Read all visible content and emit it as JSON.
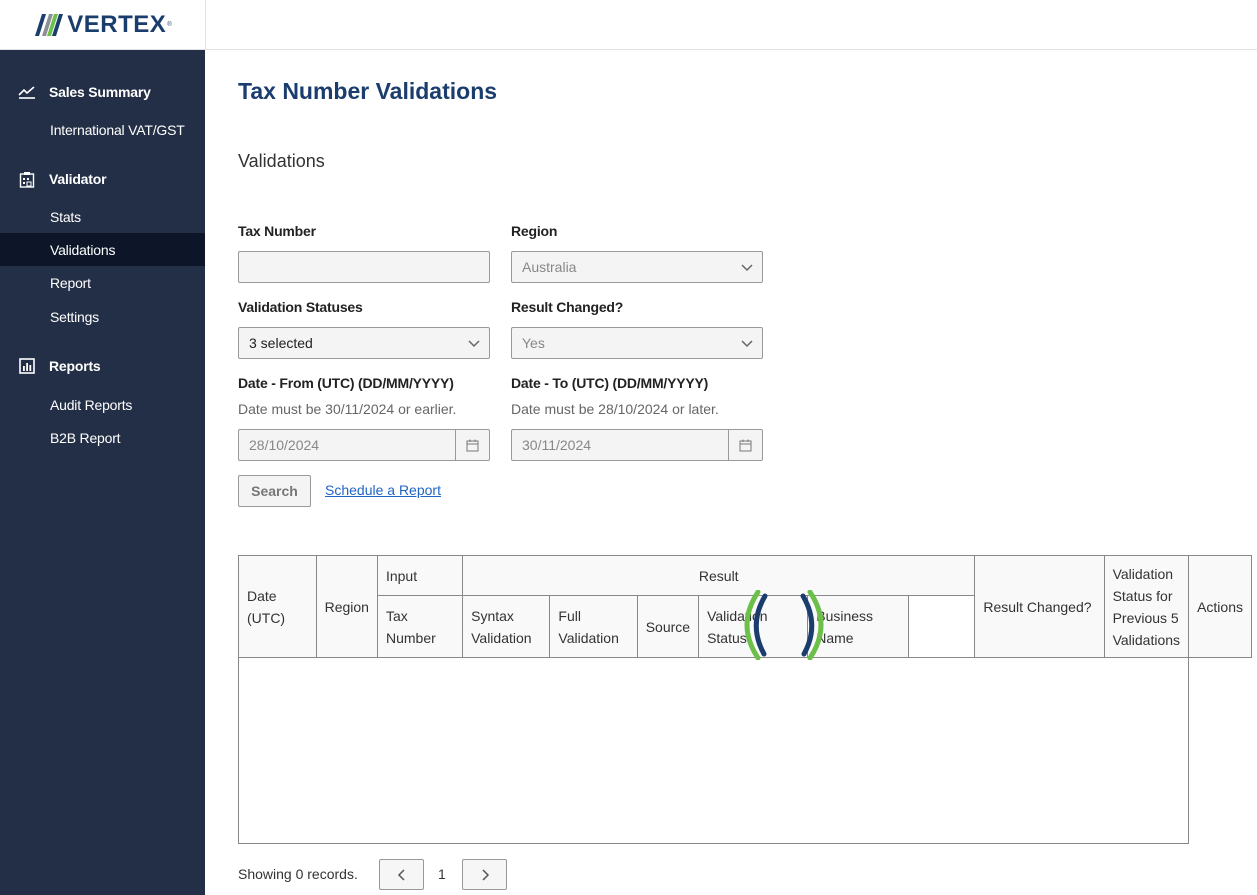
{
  "brand": {
    "name": "VERTEX",
    "registered": "®",
    "colors": {
      "navy": "#1a3d6e",
      "green": "#6cc04a",
      "gray": "#8a8f98",
      "sidebar": "#232f46",
      "sidebar_active": "#0c1628",
      "link": "#1f65c4"
    }
  },
  "sidebar": {
    "groups": [
      {
        "label": "Sales Summary",
        "icon": "trend-chart-icon",
        "items": [
          {
            "label": "International VAT/GST",
            "active": false
          }
        ]
      },
      {
        "label": "Validator",
        "icon": "clipboard-building-icon",
        "items": [
          {
            "label": "Stats",
            "active": false
          },
          {
            "label": "Validations",
            "active": true
          },
          {
            "label": "Report",
            "active": false
          },
          {
            "label": "Settings",
            "active": false
          }
        ]
      },
      {
        "label": "Reports",
        "icon": "bar-chart-icon",
        "items": [
          {
            "label": "Audit Reports",
            "active": false
          },
          {
            "label": "B2B Report",
            "active": false
          }
        ]
      }
    ]
  },
  "page": {
    "title": "Tax Number Validations",
    "section_title": "Validations"
  },
  "form": {
    "tax_number": {
      "label": "Tax Number",
      "value": ""
    },
    "region": {
      "label": "Region",
      "value": "Australia"
    },
    "validation_statuses": {
      "label": "Validation Statuses",
      "value": "3 selected"
    },
    "result_changed": {
      "label": "Result Changed?",
      "value": "Yes"
    },
    "date_from": {
      "label": "Date - From (UTC) (DD/MM/YYYY)",
      "hint": "Date must be 30/11/2024 or earlier.",
      "value": "28/10/2024"
    },
    "date_to": {
      "label": "Date - To (UTC) (DD/MM/YYYY)",
      "hint": "Date must be 28/10/2024 or later.",
      "value": "30/11/2024"
    },
    "search_label": "Search",
    "schedule_label": "Schedule a Report"
  },
  "table": {
    "headers": {
      "date": "Date (UTC)",
      "region": "Region",
      "input_group": "Input",
      "result_group": "Result",
      "tax_number": "Tax Number",
      "syntax_validation": "Syntax Validation",
      "full_validation": "Full Validation",
      "source": "Source",
      "validation_status": "Validation Status",
      "business_name": "Business Name",
      "result_changed": "Result Changed?",
      "prev5": "Validation Status for Previous 5 Validations",
      "actions": "Actions"
    },
    "rows": [],
    "loading": true
  },
  "pagination": {
    "summary": "Showing 0 records.",
    "current_page": "1",
    "prev_icon": "chevron-left-icon",
    "next_icon": "chevron-right-icon"
  }
}
